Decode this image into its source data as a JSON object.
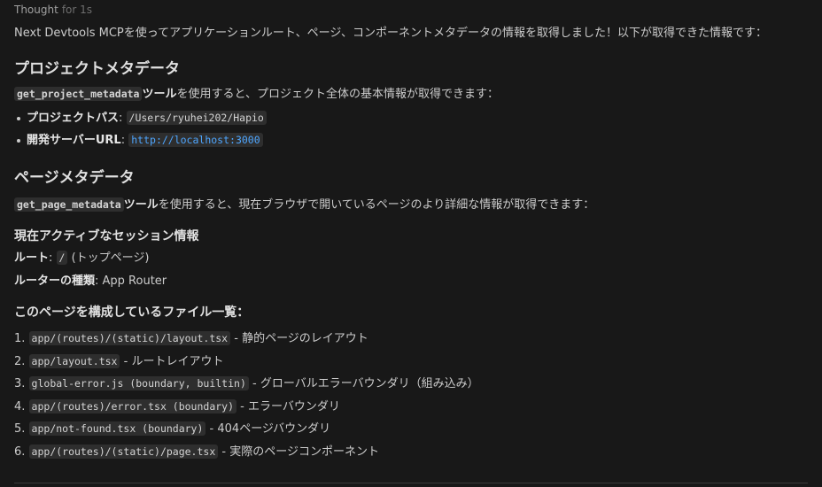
{
  "thought": {
    "label": "Thought",
    "time": "for 1s"
  },
  "intro": "Next Devtools MCPを使ってアプリケーションルート、ページ、コンポーネントメタデータの情報を取得しました！以下が取得できた情報です：",
  "project": {
    "heading": "プロジェクトメタデータ",
    "tool": "get_project_metadata",
    "tool_suffix": "ツール",
    "desc": "を使用すると、プロジェクト全体の基本情報が取得できます：",
    "items": [
      {
        "label": "プロジェクトパス",
        "sep": ": ",
        "value": "/Users/ryuhei202/Hapio",
        "link": false
      },
      {
        "label": "開発サーバーURL",
        "sep": ": ",
        "value": "http://localhost:3000",
        "link": true
      }
    ]
  },
  "page": {
    "heading": "ページメタデータ",
    "tool": "get_page_metadata",
    "tool_suffix": "ツール",
    "desc": "を使用すると、現在ブラウザで開いているページのより詳細な情報が取得できます：",
    "session_heading": "現在アクティブなセッション情報",
    "route_label": "ルート",
    "route_sep": ": ",
    "route_value": "/",
    "route_note": " (トップページ)",
    "router_label": "ルーターの種類",
    "router_sep": ": ",
    "router_value": "App Router",
    "files_heading": "このページを構成しているファイル一覧：",
    "files": [
      {
        "num": "1. ",
        "path": "app/(routes)/(static)/layout.tsx",
        "desc": " - 静的ページのレイアウト"
      },
      {
        "num": "2. ",
        "path": "app/layout.tsx",
        "desc": " - ルートレイアウト"
      },
      {
        "num": "3. ",
        "path": "global-error.js (boundary, builtin)",
        "desc": " - グローバルエラーバウンダリ（組み込み）"
      },
      {
        "num": "4. ",
        "path": "app/(routes)/error.tsx (boundary)",
        "desc": " - エラーバウンダリ"
      },
      {
        "num": "5. ",
        "path": "app/not-found.tsx (boundary)",
        "desc": " - 404ページバウンダリ"
      },
      {
        "num": "6. ",
        "path": "app/(routes)/(static)/page.tsx",
        "desc": " - 実際のページコンポーネント"
      }
    ]
  }
}
